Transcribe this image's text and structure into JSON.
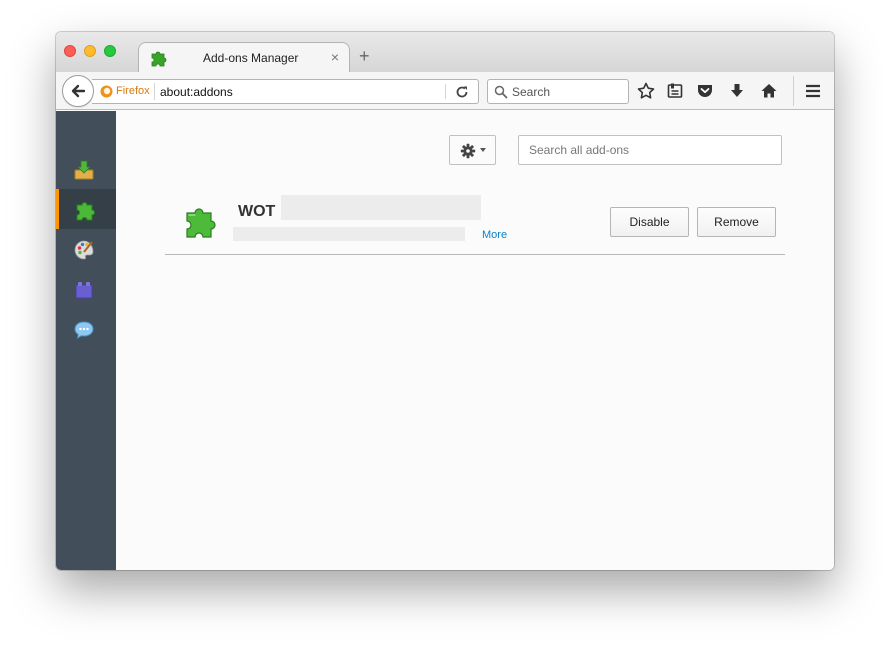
{
  "window": {
    "controls": [
      "close",
      "minimize",
      "zoom"
    ]
  },
  "tab": {
    "title": "Add-ons Manager",
    "favicon": "puzzle-piece-icon",
    "close_glyph": "×"
  },
  "new_tab_glyph": "+",
  "navbar": {
    "identity_label": "Firefox",
    "url": "about:addons",
    "search_placeholder": "Search",
    "toolbar_icons": [
      "bookmark-star-icon",
      "reading-list-icon",
      "pocket-icon",
      "downloads-icon",
      "home-icon",
      "menu-icon"
    ]
  },
  "sidebar": {
    "categories": [
      {
        "name": "get-addons",
        "icon": "download-box-icon",
        "selected": false
      },
      {
        "name": "extensions",
        "icon": "puzzle-piece-icon",
        "selected": true
      },
      {
        "name": "appearance",
        "icon": "palette-icon",
        "selected": false
      },
      {
        "name": "plugins",
        "icon": "brick-icon",
        "selected": false
      },
      {
        "name": "services",
        "icon": "speech-bubble-icon",
        "selected": false
      }
    ]
  },
  "main": {
    "search_placeholder": "Search all add-ons",
    "addon": {
      "name": "WOT",
      "more_label": "More",
      "disable_label": "Disable",
      "remove_label": "Remove"
    }
  },
  "colors": {
    "sidebar_bg": "#424f5a",
    "sidebar_selected_bg": "#343f48",
    "selected_accent": "#ff9500",
    "link": "#0a84c6",
    "firefox_orange": "#d87a0d"
  }
}
